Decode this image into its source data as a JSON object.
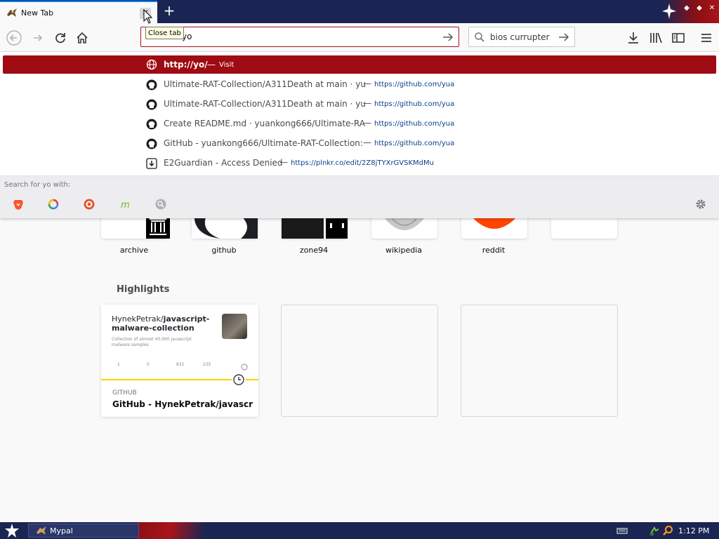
{
  "tab": {
    "title": "New Tab",
    "close_tooltip": "Close tab"
  },
  "toolbar": {
    "url_value": "yo",
    "search_value": "bios currupter"
  },
  "autocomplete": {
    "selected": {
      "url": "http://yo/",
      "dash": "—",
      "action": "Visit"
    },
    "rows": [
      {
        "icon": "github-icon",
        "title": "Ultimate-RAT-Collection/A311Death at main · yu",
        "url": "https://github.com/yua"
      },
      {
        "icon": "github-icon",
        "title": "Ultimate-RAT-Collection/A311Death at main · yu",
        "url": "https://github.com/yua"
      },
      {
        "icon": "github-icon",
        "title": "Create README.md · yuankong666/Ultimate-RA",
        "url": "https://github.com/yua"
      },
      {
        "icon": "github-icon",
        "title": "GitHub - yuankong666/Ultimate-RAT-Collection:",
        "url": "https://github.com/yua"
      },
      {
        "icon": "download-icon",
        "title": "E2Guardian - Access Denied",
        "url": "https://plnkr.co/edit/2Z8jTYXrGVSKMdMu"
      }
    ],
    "dash": "—",
    "search_with_label": "Search for yo with:",
    "engines": [
      "brave-icon",
      "google-icon",
      "duckduckgo-icon",
      "mojeek-icon",
      "search-icon"
    ]
  },
  "top_sites": [
    {
      "label": "archive"
    },
    {
      "label": "github"
    },
    {
      "label": "zone94"
    },
    {
      "label": "wikipedia"
    },
    {
      "label": "reddit"
    },
    {
      "label": ""
    }
  ],
  "highlights": {
    "title": "Highlights",
    "card": {
      "preview_owner": "HynekPetrak/",
      "preview_repo": "javascript-malware-collection",
      "preview_desc": "Collection of almost 40.000 javascript malware samples",
      "stats": [
        "1",
        "0",
        "831",
        "235"
      ],
      "source": "GITHUB",
      "title": "GitHub - HynekPetrak/javascrip..."
    }
  },
  "taskbar": {
    "task_label": "Mypal",
    "time": "1:12 PM"
  },
  "colors": {
    "accent": "#9e0b12",
    "navy": "#1b2553",
    "highlight_bar": "#ffd000"
  }
}
